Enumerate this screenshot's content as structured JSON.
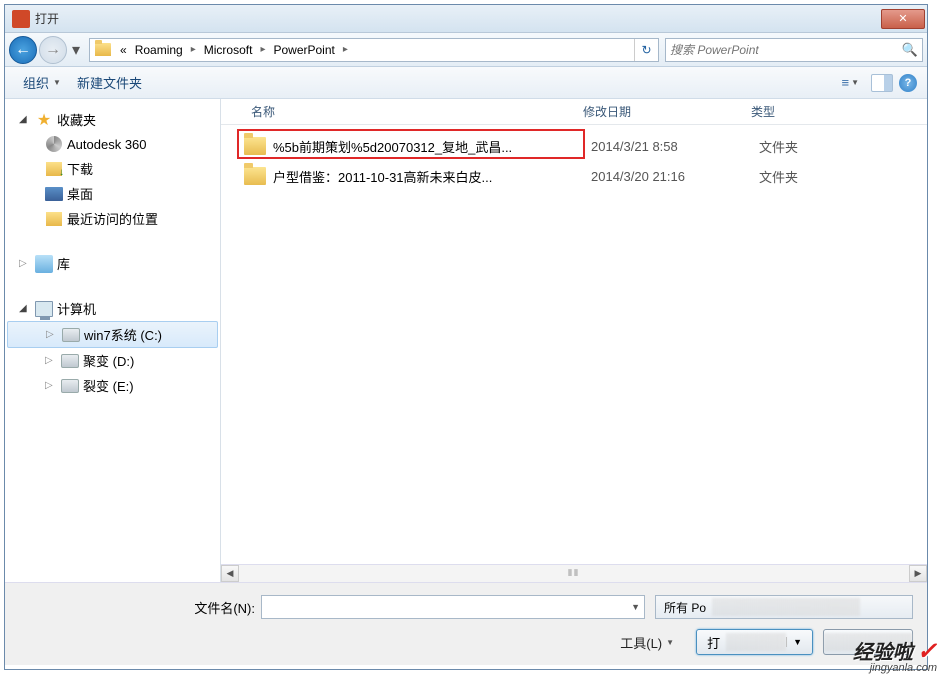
{
  "window": {
    "title": "打开",
    "close": "✕"
  },
  "nav": {
    "back_arrow": "←",
    "fwd_arrow": "→",
    "dd": "▾",
    "prefix": "«",
    "crumbs": [
      "Roaming",
      "Microsoft",
      "PowerPoint"
    ],
    "sep": "▸",
    "refresh": "↻"
  },
  "search": {
    "placeholder": "搜索 PowerPoint",
    "icon": "🔍"
  },
  "toolbar": {
    "organize": "组织",
    "newfolder": "新建文件夹",
    "dd": "▼",
    "view_icon": "≡",
    "help": "?"
  },
  "sidebar": {
    "favorites": "收藏夹",
    "autodesk": "Autodesk 360",
    "downloads": "下载",
    "desktop": "桌面",
    "recent": "最近访问的位置",
    "library": "库",
    "computer": "计算机",
    "drives": [
      {
        "label": "win7系统 (C:)",
        "selected": true,
        "arrow": "▷"
      },
      {
        "label": "聚变 (D:)",
        "selected": false,
        "arrow": "▷"
      },
      {
        "label": "裂变 (E:)",
        "selected": false,
        "arrow": "▷"
      }
    ],
    "arrow_open": "◢",
    "arrow_closed": "▷"
  },
  "columns": {
    "name": "名称",
    "date": "修改日期",
    "type": "类型"
  },
  "files": [
    {
      "name": "%5b前期策划%5d20070312_复地_武昌...",
      "date": "2014/3/21 8:58",
      "type": "文件夹",
      "highlighted": true
    },
    {
      "name": "户型借鉴：2011-10-31高新未来白皮...",
      "date": "2014/3/20 21:16",
      "type": "文件夹",
      "highlighted": false
    }
  ],
  "footer": {
    "filename_label": "文件名(N):",
    "filter": "所有 Po",
    "tools": "工具(L)",
    "open_prefix": "打",
    "dd": "▼"
  },
  "scrollbar": {
    "left": "◀",
    "right": "▶",
    "grip": "⦀⦀"
  },
  "watermark": {
    "main": "经验啦",
    "check": "✓",
    "sub": "jingyanla.com"
  }
}
